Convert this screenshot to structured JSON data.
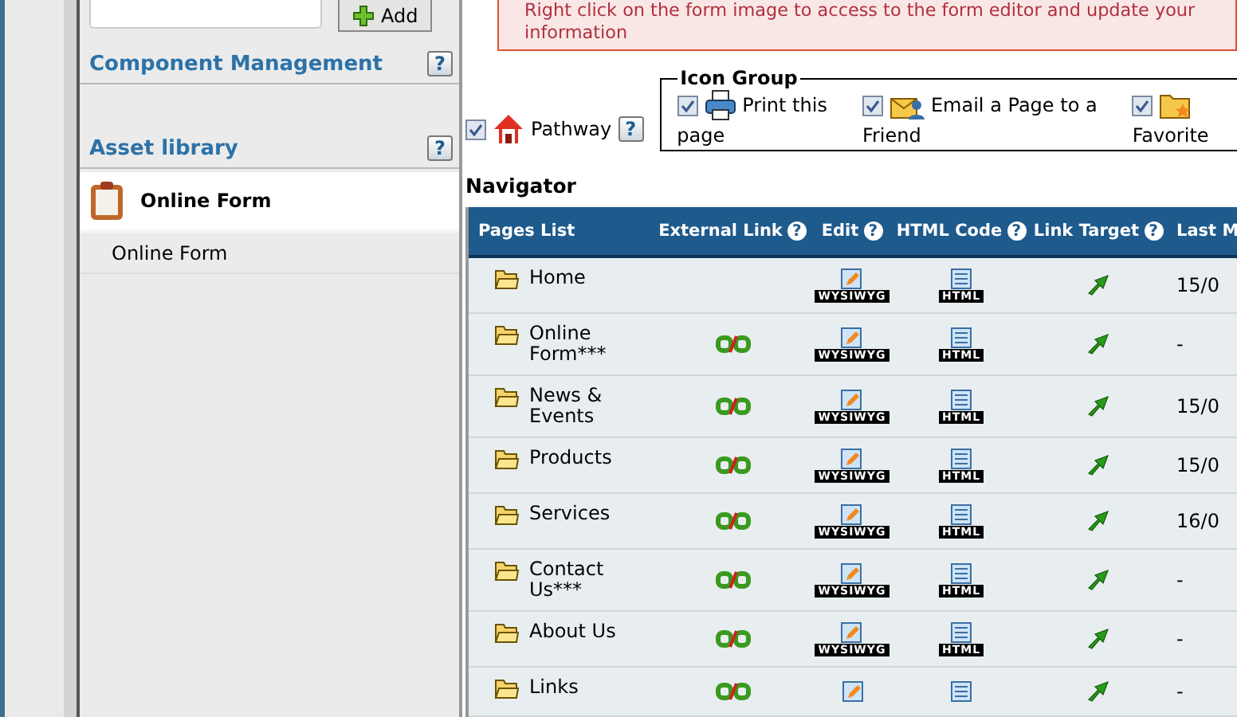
{
  "sidebar": {
    "add_button": "Add",
    "sections": [
      {
        "title": "Component Management",
        "help": "?"
      },
      {
        "title": "Asset library",
        "help": "?"
      }
    ],
    "asset": {
      "title": "Online Form",
      "items": [
        {
          "label": "Online Form"
        }
      ]
    }
  },
  "notice": {
    "lines": [
      "Right click on the form image to access to the form editor and update your",
      "information"
    ]
  },
  "pathway": {
    "label": "Pathway",
    "checked": true,
    "help": "?"
  },
  "icon_group": {
    "title": "Icon Group",
    "items": [
      {
        "kind": "printer",
        "checked": true,
        "label_1": "Print this",
        "label_2": "page"
      },
      {
        "kind": "email",
        "checked": true,
        "label_1": "Email a Page to a",
        "label_2": "Friend"
      },
      {
        "kind": "favorites",
        "checked": true,
        "label_2": "Favorite"
      }
    ]
  },
  "navigator": {
    "title": "Navigator",
    "columns": [
      {
        "label": "Pages List"
      },
      {
        "label": "External Link",
        "help": "?"
      },
      {
        "label": "Edit",
        "help": "?"
      },
      {
        "label": "HTML Code",
        "help": "?"
      },
      {
        "label": "Link Target",
        "help": "?"
      },
      {
        "label": "Last M"
      }
    ],
    "rows": [
      {
        "page": "Home",
        "external_link": false,
        "edit_label": "WYSIWYG",
        "html_label": "HTML",
        "last": "15/0"
      },
      {
        "page": "Online Form***",
        "external_link": true,
        "edit_label": "WYSIWYG",
        "html_label": "HTML",
        "last": "-"
      },
      {
        "page": "News & Events",
        "external_link": true,
        "edit_label": "WYSIWYG",
        "html_label": "HTML",
        "last": "15/0"
      },
      {
        "page": "Products",
        "external_link": true,
        "edit_label": "WYSIWYG",
        "html_label": "HTML",
        "last": "15/0"
      },
      {
        "page": "Services",
        "external_link": true,
        "edit_label": "WYSIWYG",
        "html_label": "HTML",
        "last": "16/0"
      },
      {
        "page": "Contact Us***",
        "external_link": true,
        "edit_label": "WYSIWYG",
        "html_label": "HTML",
        "last": "-"
      },
      {
        "page": "About Us",
        "external_link": true,
        "edit_label": "WYSIWYG",
        "html_label": "HTML",
        "last": "-"
      },
      {
        "page": "Links",
        "external_link": true,
        "last": "-"
      }
    ]
  }
}
